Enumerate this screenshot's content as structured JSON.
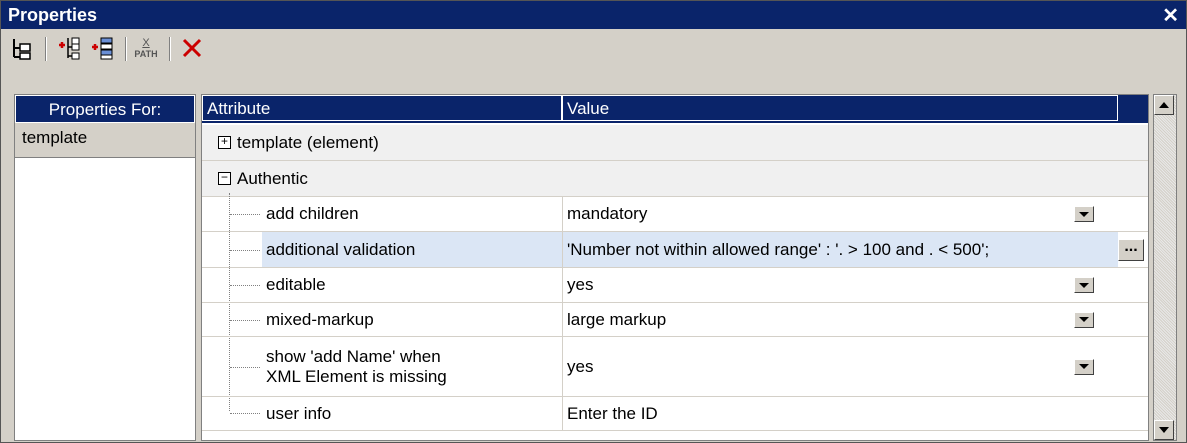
{
  "window": {
    "title": "Properties",
    "close_glyph": "✕"
  },
  "toolbar": {
    "icons": [
      "tree-view-icon",
      "add-sibling-icon",
      "add-child-icon",
      "xpath-icon",
      "delete-icon"
    ],
    "xpath_label_top": "X",
    "xpath_label_bottom": "PATH"
  },
  "left_pane": {
    "header": "Properties For:",
    "item": "template"
  },
  "grid": {
    "columns": [
      "Attribute",
      "Value"
    ],
    "groups": [
      {
        "label": "template (element)",
        "expander": "+"
      },
      {
        "label": "Authentic",
        "expander": "−"
      }
    ],
    "rows": [
      {
        "attr": "add children",
        "value": "mandatory",
        "control": "dropdown"
      },
      {
        "attr": "additional validation",
        "value": "'Number not within allowed range' : '. > 100 and . < 500';",
        "control": "ellipsis"
      },
      {
        "attr": "editable",
        "value": "yes",
        "control": "dropdown"
      },
      {
        "attr": "mixed-markup",
        "value": "large markup",
        "control": "dropdown"
      },
      {
        "attr_line1": "show 'add Name' when",
        "attr_line2": "XML Element is missing",
        "value": "yes",
        "control": "dropdown"
      },
      {
        "attr": "user info",
        "value": "Enter the ID",
        "control": "none"
      }
    ],
    "ellipsis_label": "..."
  },
  "colors": {
    "titlebar": "#0a246a",
    "chrome": "#d4d0c8",
    "selection": "#dbe6f5",
    "delete": "#cc0000"
  }
}
